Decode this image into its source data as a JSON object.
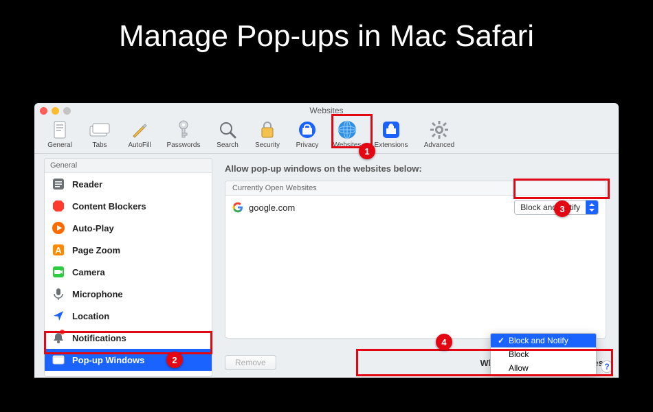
{
  "page_title": "Manage Pop-ups in Mac Safari",
  "window_title": "Websites",
  "toolbar": {
    "items": [
      {
        "label": "General"
      },
      {
        "label": "Tabs"
      },
      {
        "label": "AutoFill"
      },
      {
        "label": "Passwords"
      },
      {
        "label": "Search"
      },
      {
        "label": "Security"
      },
      {
        "label": "Privacy"
      },
      {
        "label": "Websites"
      },
      {
        "label": "Extensions"
      },
      {
        "label": "Advanced"
      }
    ]
  },
  "sidebar": {
    "header": "General",
    "items": [
      {
        "label": "Reader"
      },
      {
        "label": "Content Blockers"
      },
      {
        "label": "Auto-Play"
      },
      {
        "label": "Page Zoom"
      },
      {
        "label": "Camera"
      },
      {
        "label": "Microphone"
      },
      {
        "label": "Location"
      },
      {
        "label": "Notifications"
      },
      {
        "label": "Pop-up Windows"
      }
    ],
    "selected_index": 8
  },
  "content": {
    "title": "Allow pop-up windows on the websites below:",
    "table_header": "Currently Open Websites",
    "rows": [
      {
        "site": "google.com",
        "value": "Block and Notify"
      }
    ],
    "remove_label": "Remove",
    "footer_label": "When visiting other websites:",
    "menu_options": [
      "Block and Notify",
      "Block",
      "Allow"
    ],
    "menu_selected_index": 0,
    "help_label": "?"
  },
  "callouts": {
    "b1": "1",
    "b2": "2",
    "b3": "3",
    "b4": "4"
  }
}
